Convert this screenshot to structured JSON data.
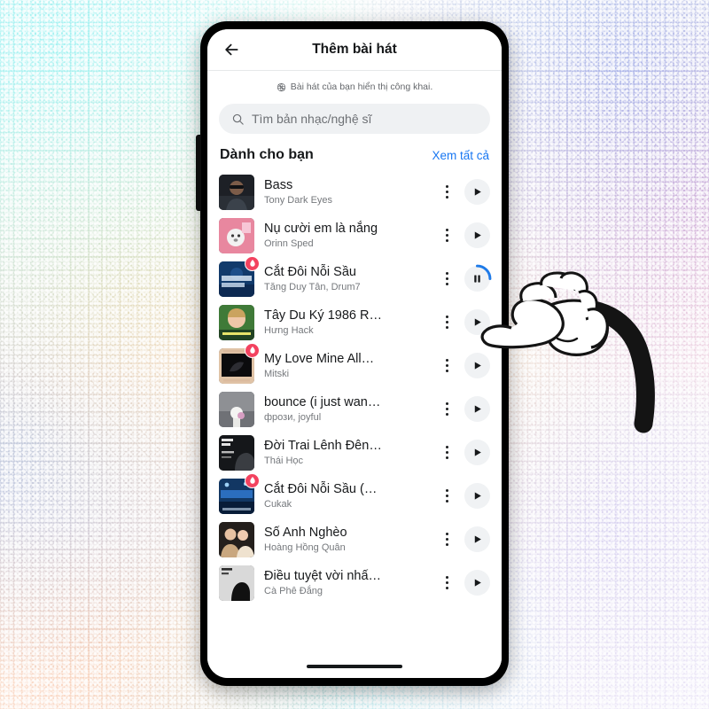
{
  "app": {
    "header": {
      "back_icon": "arrow-left-icon",
      "title": "Thêm bài hát"
    },
    "notice": {
      "icon": "globe-icon",
      "text": "Bài hát của bạn hiển thị công khai."
    },
    "search": {
      "icon": "search-icon",
      "placeholder": "Tìm bản nhạc/nghệ sĩ",
      "value": ""
    },
    "section": {
      "title": "Dành cho bạn",
      "see_all_label": "Xem tất cả",
      "see_all_color": "#1877f2"
    },
    "nav": {
      "gesture_pill": "home-indicator"
    },
    "colors": {
      "accent_link": "#1877f2",
      "badge": "#f3425f",
      "progress_arc": "#1e7ae8",
      "text_primary": "#16181a",
      "text_secondary": "#75787c"
    }
  },
  "tracks": [
    {
      "title": "Bass",
      "artist": "Tony Dark Eyes",
      "badge": false,
      "state": "play",
      "art": "portrait-sunglasses-dark"
    },
    {
      "title": "Nụ cười em là nắng",
      "artist": "Orinn Sped",
      "badge": false,
      "state": "play",
      "art": "pink-dog"
    },
    {
      "title": "Cắt Đôi Nỗi Sầu",
      "artist": "Tăng Duy Tân, Drum7",
      "badge": true,
      "state": "pause",
      "art": "blue-night-cover"
    },
    {
      "title": "Tây Du Ký 1986 R…",
      "artist": "Hưng Hack",
      "badge": false,
      "state": "play",
      "art": "green-face-cover"
    },
    {
      "title": "My Love Mine All…",
      "artist": "Mitski",
      "badge": true,
      "state": "play",
      "art": "dark-beige-frame"
    },
    {
      "title": "bounce (i just wan…",
      "artist": "фрози, joyful",
      "badge": false,
      "state": "play",
      "art": "gray-street-toy"
    },
    {
      "title": "Đời Trai Lênh Đên…",
      "artist": "Thái Học",
      "badge": false,
      "state": "play",
      "art": "dark-portrait-text"
    },
    {
      "title": "Cắt Đôi Nỗi Sầu (…",
      "artist": "Cukak",
      "badge": true,
      "state": "play",
      "art": "blue-concert-cover"
    },
    {
      "title": "Số Anh Nghèo",
      "artist": "Hoàng Hồng Quân",
      "badge": false,
      "state": "play",
      "art": "two-people-photo"
    },
    {
      "title": "Điều tuyệt vời nhấ…",
      "artist": "Cà Phê Đắng",
      "badge": false,
      "state": "play",
      "art": "bw-silhouette"
    }
  ],
  "cursor": {
    "icon": "pointing-hand-cursor",
    "target": "pause-button-track-3"
  }
}
